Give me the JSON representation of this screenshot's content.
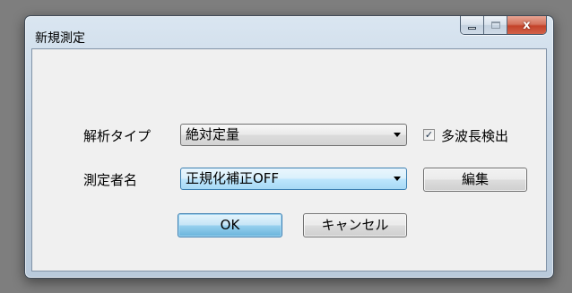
{
  "window": {
    "title": "新規測定",
    "close_glyph": "x"
  },
  "form": {
    "analysis_type_label": "解析タイプ",
    "analysis_type_value": "絶対定量",
    "multi_wavelength_label": "多波長検出",
    "multi_wavelength_checked": true,
    "operator_label": "測定者名",
    "operator_value": "正規化補正OFF",
    "edit_button_label": "編集"
  },
  "buttons": {
    "ok_label": "OK",
    "cancel_label": "キャンセル"
  },
  "icons": {
    "minimize": "minimize-icon",
    "maximize": "maximize-icon",
    "close": "close-icon",
    "dropdown": "chevron-down-icon",
    "check": "checkmark-icon"
  }
}
